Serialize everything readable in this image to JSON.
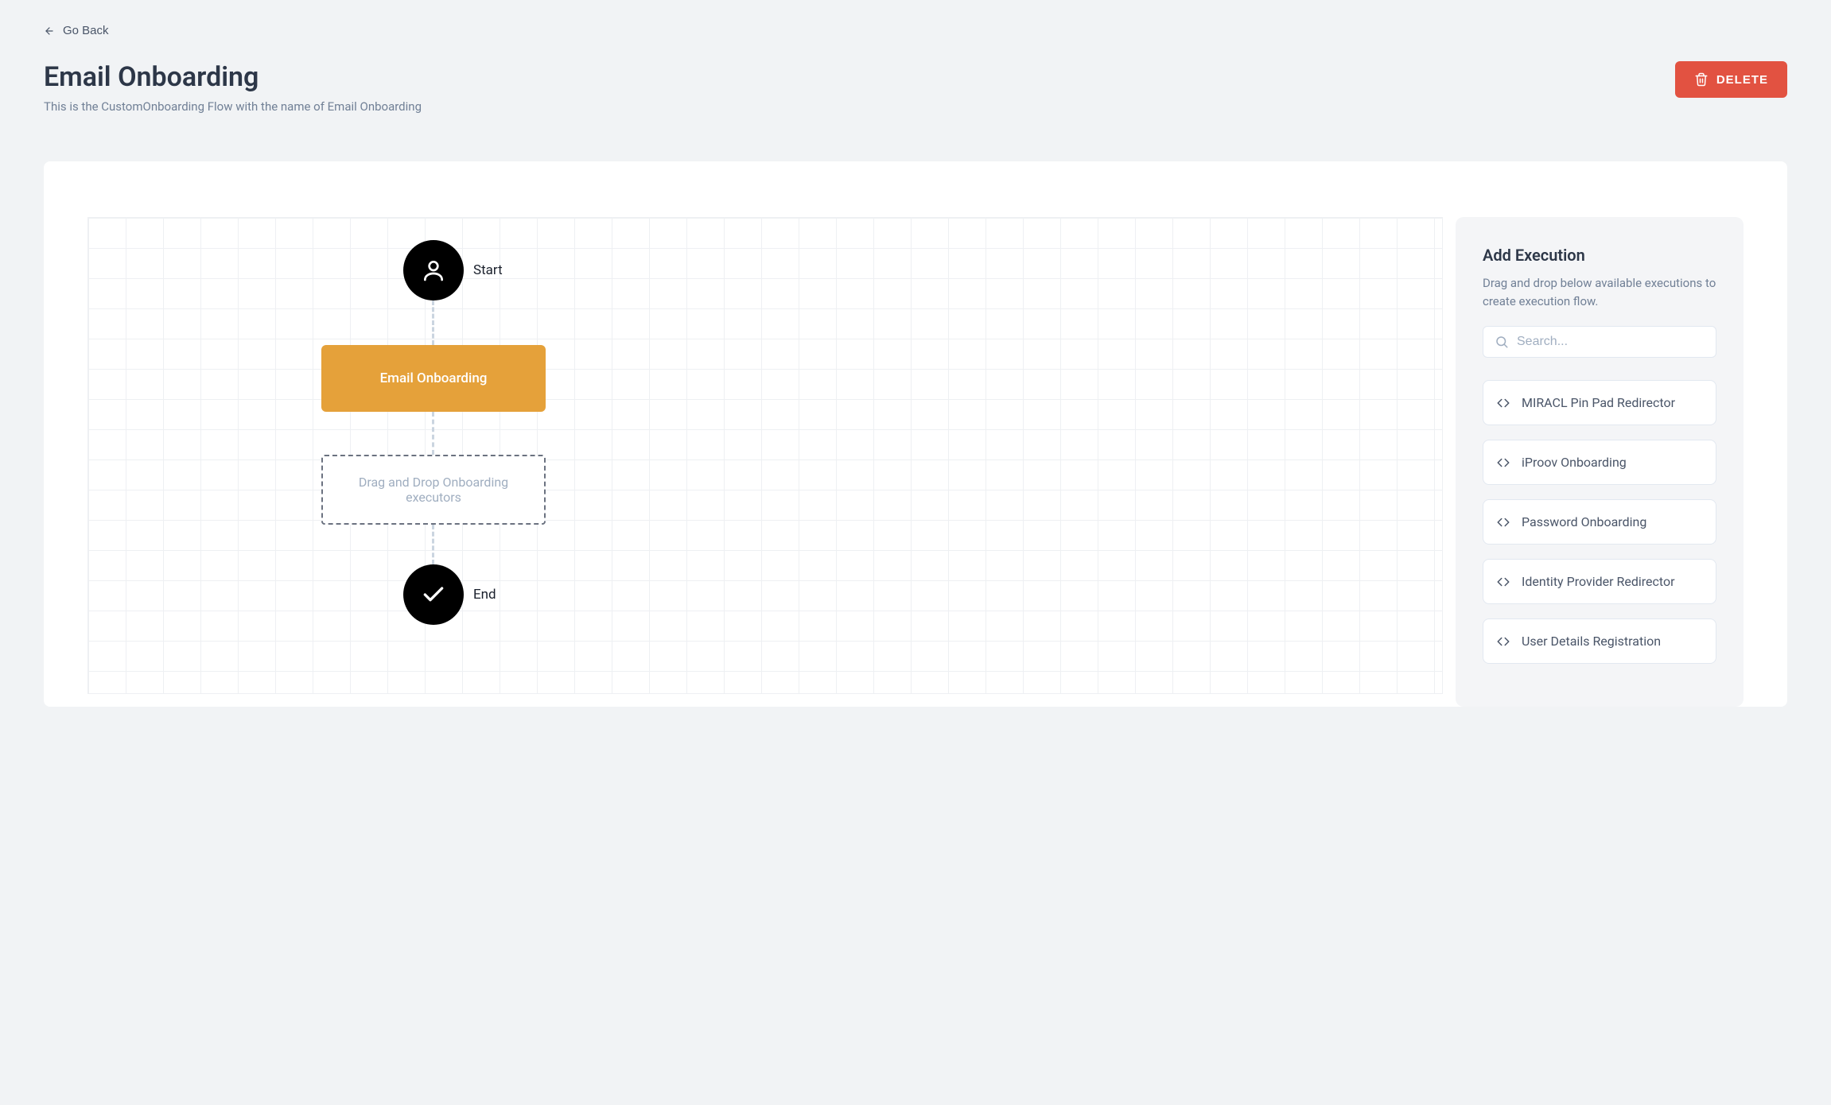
{
  "nav": {
    "go_back": "Go Back"
  },
  "header": {
    "title": "Email Onboarding",
    "subtitle": "This is the CustomOnboarding Flow with the name of Email Onboarding",
    "delete_label": "DELETE"
  },
  "flow": {
    "start_label": "Start",
    "end_label": "End",
    "box_label": "Email Onboarding",
    "drop_hint": "Drag and Drop Onboarding executors"
  },
  "sidebar": {
    "title": "Add Execution",
    "subtitle": "Drag and drop below available executions to create execution flow.",
    "search_placeholder": "Search...",
    "executions": [
      {
        "label": "MIRACL Pin Pad Redirector"
      },
      {
        "label": "iProov Onboarding"
      },
      {
        "label": "Password Onboarding"
      },
      {
        "label": "Identity Provider Redirector"
      },
      {
        "label": "User Details Registration"
      }
    ]
  }
}
